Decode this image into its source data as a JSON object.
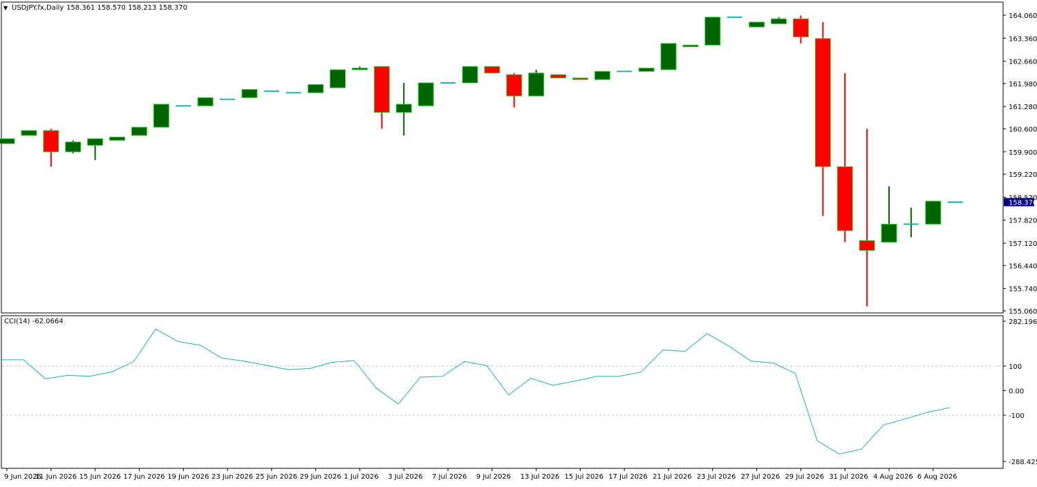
{
  "header": {
    "symbol_label": "USDJPY.fx,Daily",
    "ohlc_text": "158.361 158.570 158.213 158.370"
  },
  "current_price_label": "158.370",
  "colors": {
    "bull_body": "#006400",
    "bear_body": "#ff0000",
    "candle_outline": "#32cd32",
    "bear_wick": "#ff0000",
    "cci_line": "#20b2aa",
    "price_tag_bg": "#000080",
    "grid_dash": "#c0c0c0"
  },
  "chart_data": [
    {
      "type": "candlestick",
      "title": "USDJPY.fx,Daily",
      "y_ticks": [
        "164.060",
        "163.360",
        "162.660",
        "161.980",
        "161.280",
        "160.600",
        "159.900",
        "159.220",
        "158.520",
        "157.820",
        "157.120",
        "156.440",
        "155.740",
        "155.060"
      ],
      "x_tick_labels": [
        "9 Jun 2026",
        "11 Jun 2026",
        "15 Jun 2026",
        "17 Jun 2026",
        "19 Jun 2026",
        "23 Jun 2026",
        "25 Jun 2026",
        "29 Jun 2026",
        "1 Jul 2026",
        "3 Jul 2026",
        "7 Jul 2026",
        "9 Jul 2026",
        "13 Jul 2026",
        "15 Jul 2026",
        "17 Jul 2026",
        "21 Jul 2026",
        "23 Jul 2026",
        "27 Jul 2026",
        "29 Jul 2026",
        "31 Jul 2026",
        "4 Aug 2026",
        "6 Aug 2026"
      ],
      "ylim": [
        155.0,
        164.3
      ],
      "candles": [
        {
          "o": 160.15,
          "h": 160.3,
          "l": 160.15,
          "c": 160.3
        },
        {
          "o": 160.4,
          "h": 160.55,
          "l": 160.4,
          "c": 160.55
        },
        {
          "o": 160.55,
          "h": 160.6,
          "l": 159.45,
          "c": 159.9
        },
        {
          "o": 159.9,
          "h": 160.25,
          "l": 159.85,
          "c": 160.2
        },
        {
          "o": 160.1,
          "h": 160.3,
          "l": 159.65,
          "c": 160.3
        },
        {
          "o": 160.25,
          "h": 160.35,
          "l": 160.25,
          "c": 160.35
        },
        {
          "o": 160.4,
          "h": 160.65,
          "l": 160.4,
          "c": 160.65
        },
        {
          "o": 160.65,
          "h": 161.35,
          "l": 160.65,
          "c": 161.35
        },
        {
          "o": 161.3,
          "h": 161.3,
          "l": 161.3,
          "c": 161.3
        },
        {
          "o": 161.3,
          "h": 161.55,
          "l": 161.3,
          "c": 161.55
        },
        {
          "o": 161.5,
          "h": 161.5,
          "l": 161.5,
          "c": 161.5
        },
        {
          "o": 161.55,
          "h": 161.8,
          "l": 161.55,
          "c": 161.8
        },
        {
          "o": 161.75,
          "h": 161.75,
          "l": 161.75,
          "c": 161.75
        },
        {
          "o": 161.7,
          "h": 161.7,
          "l": 161.7,
          "c": 161.7
        },
        {
          "o": 161.7,
          "h": 161.95,
          "l": 161.7,
          "c": 161.95
        },
        {
          "o": 161.85,
          "h": 162.4,
          "l": 161.85,
          "c": 162.4
        },
        {
          "o": 162.4,
          "h": 162.5,
          "l": 162.4,
          "c": 162.45
        },
        {
          "o": 162.5,
          "h": 162.5,
          "l": 160.6,
          "c": 161.1
        },
        {
          "o": 161.1,
          "h": 162.0,
          "l": 160.4,
          "c": 161.35
        },
        {
          "o": 161.3,
          "h": 162.0,
          "l": 161.3,
          "c": 162.0
        },
        {
          "o": 162.0,
          "h": 162.0,
          "l": 162.0,
          "c": 162.0
        },
        {
          "o": 162.0,
          "h": 162.5,
          "l": 162.0,
          "c": 162.5
        },
        {
          "o": 162.5,
          "h": 162.5,
          "l": 162.3,
          "c": 162.3
        },
        {
          "o": 162.25,
          "h": 162.3,
          "l": 161.25,
          "c": 161.6
        },
        {
          "o": 161.6,
          "h": 162.4,
          "l": 161.6,
          "c": 162.3
        },
        {
          "o": 162.25,
          "h": 162.25,
          "l": 162.15,
          "c": 162.15
        },
        {
          "o": 162.15,
          "h": 162.15,
          "l": 162.1,
          "c": 162.1
        },
        {
          "o": 162.1,
          "h": 162.35,
          "l": 162.1,
          "c": 162.35
        },
        {
          "o": 162.35,
          "h": 162.35,
          "l": 162.35,
          "c": 162.35
        },
        {
          "o": 162.35,
          "h": 162.45,
          "l": 162.35,
          "c": 162.45
        },
        {
          "o": 162.4,
          "h": 163.2,
          "l": 162.4,
          "c": 163.2
        },
        {
          "o": 163.1,
          "h": 163.15,
          "l": 163.1,
          "c": 163.15
        },
        {
          "o": 163.15,
          "h": 164.0,
          "l": 163.15,
          "c": 164.0
        },
        {
          "o": 164.0,
          "h": 164.0,
          "l": 164.0,
          "c": 164.0
        },
        {
          "o": 163.7,
          "h": 163.85,
          "l": 163.7,
          "c": 163.85
        },
        {
          "o": 163.8,
          "h": 164.0,
          "l": 163.8,
          "c": 163.95
        },
        {
          "o": 163.95,
          "h": 164.05,
          "l": 163.2,
          "c": 163.4
        },
        {
          "o": 163.35,
          "h": 163.85,
          "l": 157.95,
          "c": 159.45
        },
        {
          "o": 159.45,
          "h": 162.3,
          "l": 157.15,
          "c": 157.5
        },
        {
          "o": 157.2,
          "h": 160.6,
          "l": 155.2,
          "c": 156.9
        },
        {
          "o": 157.15,
          "h": 158.85,
          "l": 157.15,
          "c": 157.7
        },
        {
          "o": 157.7,
          "h": 158.2,
          "l": 157.3,
          "c": 157.7
        },
        {
          "o": 157.7,
          "h": 158.4,
          "l": 157.7,
          "c": 158.4
        },
        {
          "o": 158.37,
          "h": 158.37,
          "l": 158.37,
          "c": 158.37
        }
      ]
    },
    {
      "type": "line",
      "title": "CCI(14) -62.0664",
      "y_ticks": [
        "282.1967",
        "100",
        "0.00",
        "-100",
        "-288.4258"
      ],
      "ylim": [
        -288.4258,
        282.1967
      ],
      "levels": [
        100,
        -100
      ],
      "series": [
        {
          "values": [
            125,
            125,
            48,
            62,
            58,
            76,
            118,
            250,
            200,
            185,
            132,
            120,
            103,
            85,
            90,
            115,
            122,
            10,
            -55,
            55,
            58,
            118,
            102,
            -18,
            50,
            22,
            38,
            58,
            58,
            75,
            165,
            160,
            232,
            180,
            120,
            112,
            70,
            -205,
            -258,
            -238,
            -140,
            -115,
            -88,
            -70
          ]
        }
      ]
    }
  ]
}
